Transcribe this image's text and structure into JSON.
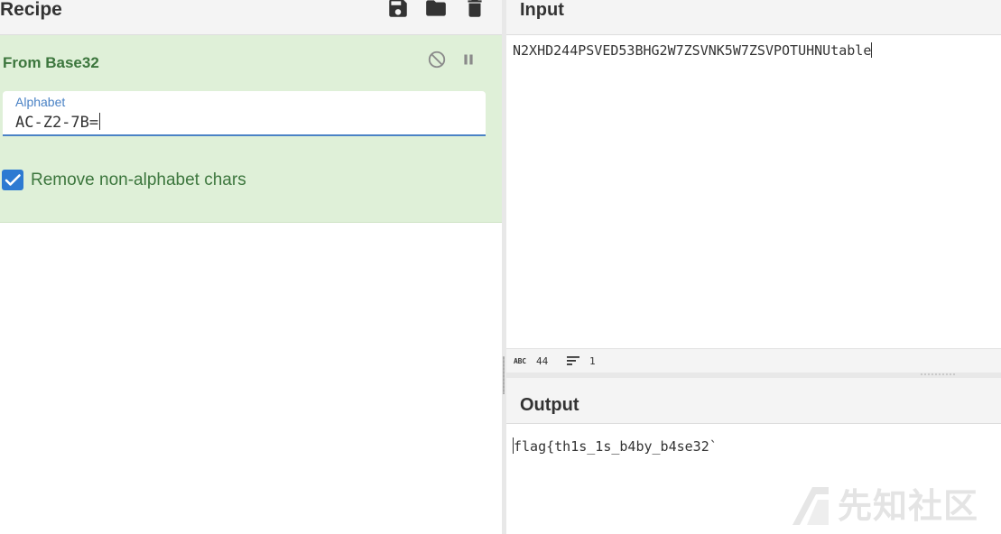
{
  "recipe": {
    "title": "Recipe",
    "icons": [
      "save-icon",
      "folder-icon",
      "trash-icon"
    ]
  },
  "operation": {
    "name": "From Base32",
    "disable_icon": "disable-icon",
    "pause_icon": "pause-icon",
    "alphabet_label": "Alphabet",
    "alphabet_value": "AC-Z2-7B=",
    "remove_non_alpha_label": "Remove non-alphabet chars",
    "remove_non_alpha_checked": true
  },
  "input": {
    "title": "Input",
    "text": "N2XHD244PSVED53BHG2W7ZSVNK5W7ZSVPOTUHNUtable",
    "status": {
      "abc_icon": "ABC",
      "length": "44",
      "lines": "1"
    }
  },
  "output": {
    "title": "Output",
    "text": "flag{th1s_1s_b4by_b4se32`"
  },
  "watermark": {
    "text": "先知社区"
  },
  "colors": {
    "recipe_card_bg": "#dff0d8",
    "recipe_title": "#3c763d",
    "accent": "#2d7ad2",
    "header_bg": "#f4f4f4"
  }
}
